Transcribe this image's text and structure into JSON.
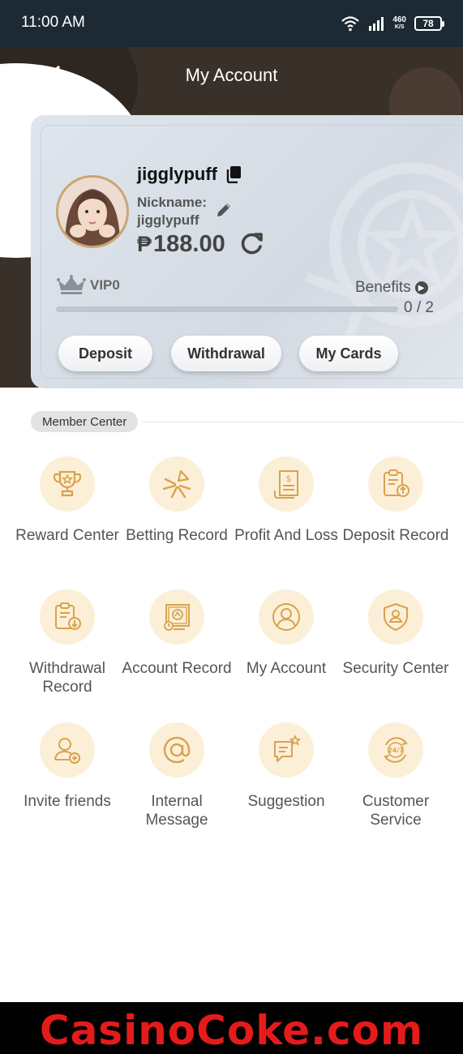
{
  "status_bar": {
    "time": "11:00 AM",
    "net_speed": "460",
    "net_speed_unit": "K/S",
    "battery": "78"
  },
  "header": {
    "title": "My Account"
  },
  "account": {
    "username": "jigglypuff",
    "nickname_label": "Nickname:",
    "nickname": "jigglypuff",
    "currency_symbol": "₱",
    "balance": "188.00",
    "vip_level": "VIP0",
    "benefits_label": "Benefits",
    "progress_text": "0 / 2",
    "progress_fraction": 0.0,
    "buttons": {
      "deposit": "Deposit",
      "withdrawal": "Withdrawal",
      "my_cards": "My Cards"
    }
  },
  "member_center": {
    "title": "Member Center",
    "items": [
      {
        "label": "Reward Center",
        "icon": "trophy-icon"
      },
      {
        "label": "Betting Record",
        "icon": "betting-record-icon"
      },
      {
        "label": "Profit And Loss",
        "icon": "profit-loss-icon"
      },
      {
        "label": "Deposit Record",
        "icon": "deposit-record-icon"
      },
      {
        "label": "Withdrawal Record",
        "icon": "withdrawal-record-icon"
      },
      {
        "label": "Account Record",
        "icon": "account-record-icon"
      },
      {
        "label": "My Account",
        "icon": "user-icon"
      },
      {
        "label": "Security Center",
        "icon": "shield-icon"
      },
      {
        "label": "Invite friends",
        "icon": "invite-user-icon"
      },
      {
        "label": "Internal Message",
        "icon": "at-icon"
      },
      {
        "label": "Suggestion",
        "icon": "suggestion-icon"
      },
      {
        "label": "Customer Service",
        "icon": "support-24-7-icon"
      }
    ]
  },
  "watermark": "CasinoCoke.com",
  "colors": {
    "accent_gold": "#d9a24d",
    "icon_bg": "#fcefd7",
    "watermark_red": "#e41b1b"
  }
}
